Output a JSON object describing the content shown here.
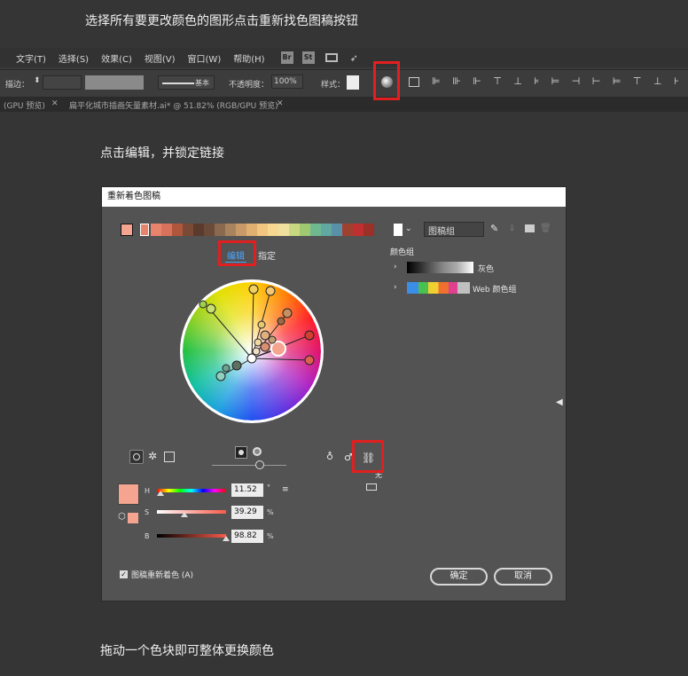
{
  "captions": {
    "top": "选择所有要更改颜色的图形点击重新找色图稿按钮",
    "middle": "点击编辑，并锁定链接",
    "bottom": "拖动一个色块即可整体更换颜色"
  },
  "menubar": {
    "items": [
      "文字(T)",
      "选择(S)",
      "效果(C)",
      "视图(V)",
      "窗口(W)",
      "帮助(H)"
    ],
    "app_icons": [
      "Br",
      "St"
    ]
  },
  "controlbar": {
    "stroke_label": "描边：",
    "stroke_style": "基本",
    "opacity_label": "不透明度：",
    "opacity_value": "100%",
    "style_label": "样式："
  },
  "tabs": {
    "tab1": "(GPU 预览)",
    "tab2": "扁平化城市插画矢量素材.ai* @ 51.82% (RGB/GPU 预览)"
  },
  "dialog": {
    "title": "重新着色图稿",
    "preset_select": "图稿组",
    "tab_edit": "编辑",
    "tab_assign": "指定",
    "color_groups_label": "颜色组",
    "groups": [
      {
        "name": "灰色"
      },
      {
        "name": "Web 颜色组"
      }
    ],
    "h_label": "H",
    "s_label": "S",
    "b_label": "B",
    "h_value": "11.52",
    "s_value": "39.29",
    "b_value": "98.82",
    "h_unit": "°",
    "s_unit": "%",
    "b_unit": "%",
    "link_label": "无",
    "recolor_checkbox": "图稿重新着色 (A)",
    "ok": "确定",
    "cancel": "取消",
    "accent": "#f5a48f",
    "palette": [
      "#e8846c",
      "#d8725a",
      "#b0563c",
      "#7a4a36",
      "#5a3a2c",
      "#6a4a38",
      "#8a6a4e",
      "#a8845e",
      "#c89a68",
      "#e0b070",
      "#f2c680",
      "#f6d890",
      "#f0e0a0",
      "#c8d880",
      "#a0c870",
      "#70b890",
      "#60a8a0",
      "#5890a8",
      "#a04030",
      "#c03030",
      "#9a3028"
    ]
  }
}
